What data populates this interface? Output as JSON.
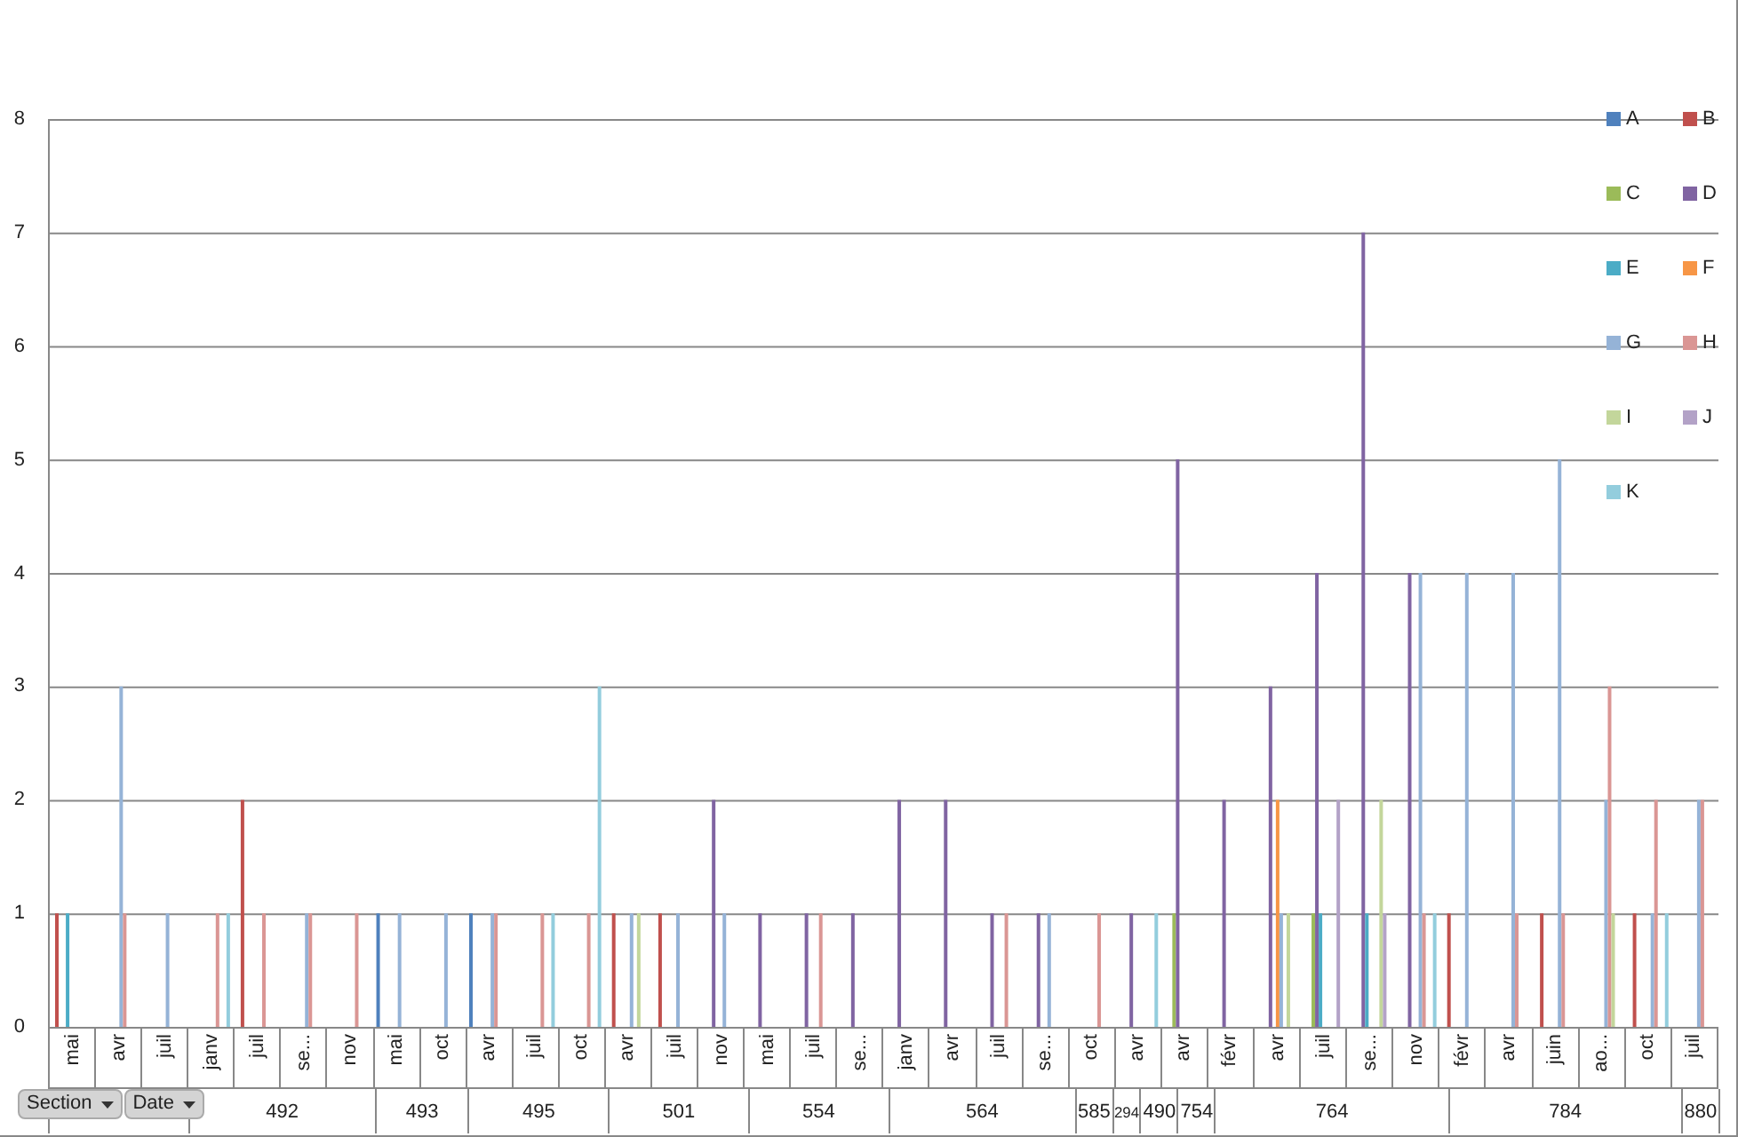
{
  "chart_data": {
    "type": "bar",
    "grid": true,
    "ylim": [
      0,
      8
    ],
    "yticks": [
      0,
      1,
      2,
      3,
      4,
      5,
      6,
      7,
      8
    ],
    "series": [
      {
        "name": "A",
        "color": "#4f81bd",
        "values": [
          null,
          null,
          null,
          null,
          null,
          null,
          null,
          1,
          null,
          1,
          null,
          null,
          null,
          null,
          null,
          null,
          null,
          null,
          null,
          null,
          null,
          null,
          null,
          null,
          null,
          null,
          null,
          null,
          null,
          null,
          null,
          null,
          null,
          null,
          null,
          null
        ]
      },
      {
        "name": "B",
        "color": "#c0504d",
        "values": [
          1,
          null,
          null,
          null,
          2,
          null,
          null,
          null,
          null,
          null,
          null,
          null,
          1,
          1,
          null,
          null,
          null,
          null,
          null,
          null,
          null,
          null,
          null,
          null,
          null,
          null,
          null,
          null,
          null,
          null,
          1,
          null,
          1,
          null,
          1,
          null
        ]
      },
      {
        "name": "C",
        "color": "#9bbb59",
        "values": [
          null,
          null,
          null,
          null,
          null,
          null,
          null,
          null,
          null,
          null,
          null,
          null,
          null,
          null,
          null,
          null,
          null,
          null,
          null,
          null,
          null,
          null,
          null,
          null,
          1,
          null,
          null,
          1,
          null,
          null,
          null,
          null,
          null,
          null,
          null,
          null
        ]
      },
      {
        "name": "D",
        "color": "#8064a2",
        "values": [
          null,
          null,
          null,
          null,
          null,
          null,
          null,
          null,
          null,
          null,
          null,
          null,
          null,
          null,
          2,
          1,
          1,
          1,
          2,
          2,
          1,
          1,
          null,
          1,
          5,
          2,
          3,
          4,
          7,
          4,
          null,
          null,
          null,
          null,
          null,
          null
        ]
      },
      {
        "name": "E",
        "color": "#4bacc6",
        "values": [
          1,
          null,
          null,
          null,
          null,
          null,
          null,
          null,
          null,
          null,
          null,
          null,
          null,
          null,
          null,
          null,
          null,
          null,
          null,
          null,
          null,
          null,
          null,
          null,
          null,
          null,
          null,
          1,
          1,
          null,
          null,
          null,
          null,
          null,
          null,
          null
        ]
      },
      {
        "name": "F",
        "color": "#f79646",
        "values": [
          null,
          null,
          null,
          null,
          null,
          null,
          null,
          null,
          null,
          null,
          null,
          null,
          null,
          null,
          null,
          null,
          null,
          null,
          null,
          null,
          null,
          null,
          null,
          null,
          null,
          null,
          2,
          null,
          null,
          null,
          null,
          null,
          null,
          null,
          null,
          null
        ]
      },
      {
        "name": "G",
        "color": "#95b3d7",
        "values": [
          null,
          3,
          1,
          null,
          null,
          1,
          null,
          1,
          1,
          1,
          null,
          null,
          1,
          1,
          1,
          null,
          null,
          null,
          null,
          null,
          null,
          1,
          null,
          null,
          null,
          null,
          1,
          null,
          null,
          4,
          4,
          4,
          5,
          2,
          1,
          2
        ]
      },
      {
        "name": "H",
        "color": "#da9694",
        "values": [
          null,
          1,
          null,
          1,
          1,
          1,
          1,
          null,
          null,
          1,
          1,
          1,
          null,
          null,
          null,
          null,
          1,
          null,
          null,
          null,
          1,
          null,
          1,
          null,
          null,
          null,
          null,
          null,
          null,
          1,
          null,
          1,
          1,
          3,
          2,
          2
        ]
      },
      {
        "name": "I",
        "color": "#c3d69b",
        "values": [
          null,
          null,
          null,
          null,
          null,
          null,
          null,
          null,
          null,
          null,
          null,
          null,
          1,
          null,
          null,
          null,
          null,
          null,
          null,
          null,
          null,
          null,
          null,
          null,
          null,
          null,
          1,
          null,
          2,
          null,
          null,
          null,
          null,
          1,
          null,
          null
        ]
      },
      {
        "name": "J",
        "color": "#b3a2c7",
        "values": [
          null,
          null,
          null,
          null,
          null,
          null,
          null,
          null,
          null,
          null,
          null,
          null,
          null,
          null,
          null,
          null,
          null,
          null,
          null,
          null,
          null,
          null,
          null,
          null,
          null,
          null,
          null,
          2,
          1,
          null,
          null,
          null,
          null,
          null,
          null,
          null
        ]
      },
      {
        "name": "K",
        "color": "#93cddd",
        "values": [
          null,
          null,
          null,
          1,
          null,
          null,
          null,
          null,
          null,
          null,
          1,
          3,
          null,
          null,
          null,
          null,
          null,
          null,
          null,
          null,
          null,
          null,
          null,
          1,
          null,
          null,
          null,
          null,
          null,
          1,
          null,
          null,
          null,
          null,
          1,
          null
        ]
      }
    ]
  },
  "category_axis": [
    {
      "months": [
        "mai",
        "avr",
        "juil"
      ]
    },
    {
      "section": "492",
      "months": [
        "janv",
        "juil",
        "se...",
        "nov"
      ]
    },
    {
      "section": "493",
      "months": [
        "mai",
        "oct"
      ]
    },
    {
      "section": "495",
      "months": [
        "avr",
        "juil",
        "oct"
      ]
    },
    {
      "section": "501",
      "months": [
        "avr",
        "juil",
        "nov"
      ]
    },
    {
      "section": "554",
      "months": [
        "mai",
        "juil",
        "se..."
      ]
    },
    {
      "section": "564",
      "months": [
        "janv",
        "avr",
        "juil",
        "se..."
      ]
    },
    {
      "section": "585",
      "months": [
        "oct"
      ]
    },
    {
      "section": "294"
    },
    {
      "section": "490",
      "months": [
        "avr"
      ]
    },
    {
      "section": "754",
      "months": [
        "avr"
      ]
    },
    {
      "section": "764",
      "months": [
        "févr",
        "avr",
        "juil",
        "se...",
        "nov"
      ]
    },
    {
      "section": "784",
      "months": [
        "févr",
        "avr",
        "juin",
        "ao...",
        "oct"
      ]
    },
    {
      "section": "880",
      "months": [
        "juil"
      ]
    }
  ],
  "filter_buttons": [
    {
      "label": "Section"
    },
    {
      "label": "Date"
    }
  ]
}
